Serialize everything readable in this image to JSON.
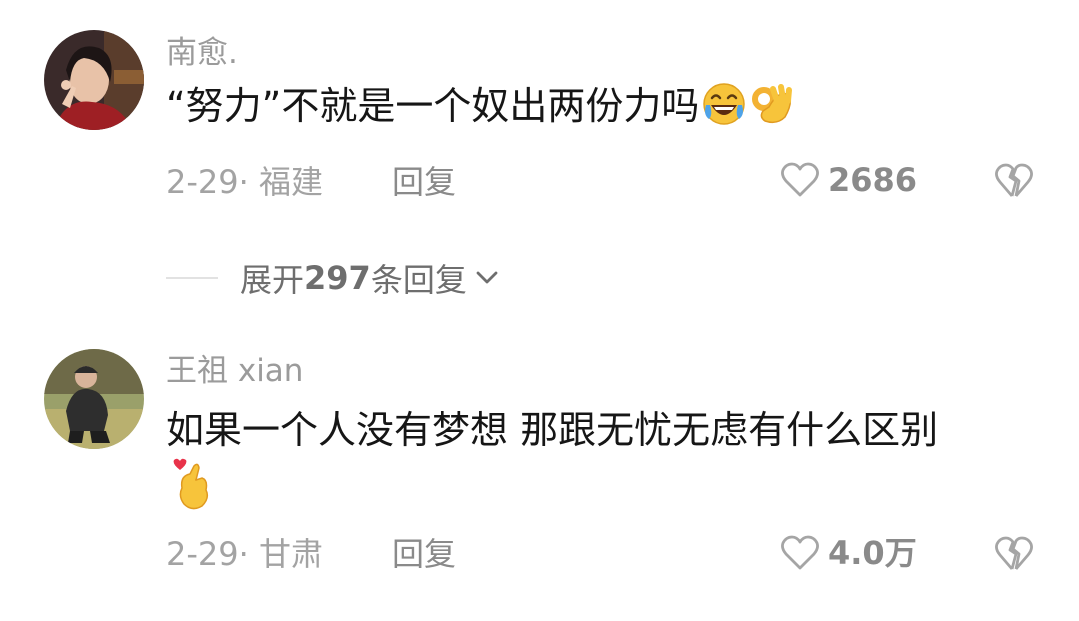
{
  "comments": [
    {
      "username": "南愈.",
      "text": "“努力”不就是一个奴出两份力吗",
      "emojis": [
        "rolling-laughing-emoji",
        "ok-hand-emoji"
      ],
      "date_location": "2-29· 福建",
      "reply_label": "回复",
      "like_count": "2686"
    },
    {
      "username": "王祖 xian",
      "text": "如果一个人没有梦想  那跟无忧无虑有什么区别",
      "emojis": [
        "finger-heart-emoji"
      ],
      "date_location": "2-29· 甘肃",
      "reply_label": "回复",
      "like_count": "4.0万"
    }
  ],
  "expand_replies": {
    "prefix": "展开 ",
    "count": "297",
    "suffix": " 条回复"
  },
  "colors": {
    "text": "#161616",
    "muted": "#9b9b9b",
    "icon": "#a5a5a5"
  }
}
